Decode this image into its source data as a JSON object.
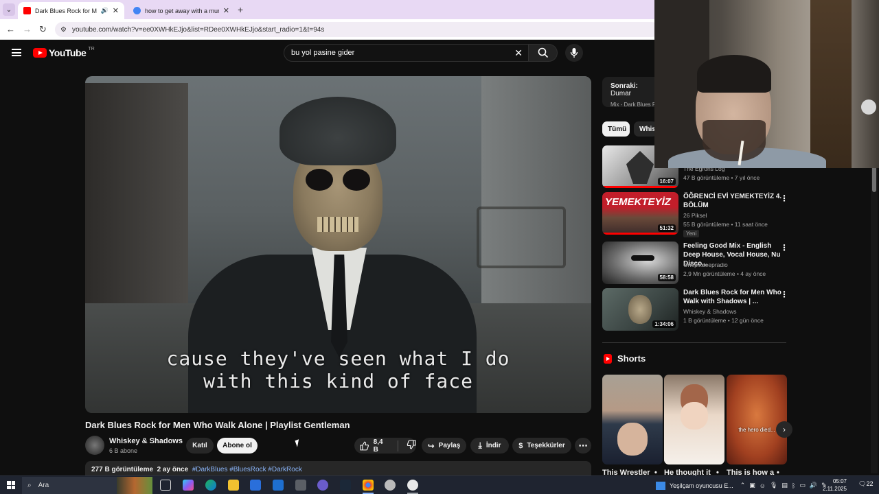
{
  "browser": {
    "tabs": [
      {
        "label": "Dark Blues Rock for Men W",
        "active": true,
        "favicon_color": "#ff0000"
      },
      {
        "label": "how to get away with a murder",
        "active": false,
        "favicon_color": "#4285f4"
      }
    ],
    "url": "youtube.com/watch?v=ee0XWHkEJjo&list=RDee0XWHkEJjo&start_radio=1&t=94s"
  },
  "youtube": {
    "logo_text": "YouTube",
    "country": "TR",
    "search_value": "bu yol pasine gider"
  },
  "video": {
    "lyric_line1": "cause they've seen what I do",
    "lyric_line2": "with this kind of face",
    "title": "Dark Blues Rock for Men Who Walk Alone | Playlist Gentleman",
    "channel_name": "Whiskey & Shadows",
    "subscribers": "6 B abone",
    "join_label": "Katıl",
    "subscribe_label": "Abone ol",
    "likes": "8,4 B",
    "share_label": "Paylaş",
    "download_label": "İndir",
    "thanks_label": "Teşekkürler",
    "views": "277 B görüntüleme",
    "date": "2 ay önce",
    "hashtags": "#DarkBlues #BluesRock #DarkRock"
  },
  "sidebar": {
    "next_label": "Sonraki:",
    "next_title": "Dumar",
    "next_mix": "Mix - Dark Blues R",
    "chips": [
      "Tümü",
      "Whisk"
    ],
    "recommendations": [
      {
        "duration": "16:07",
        "title": "",
        "channel": "The Egrons Log",
        "meta": "47 B görüntüleme • 7 yıl önce",
        "badge": ""
      },
      {
        "duration": "51:32",
        "title": "ÖĞRENCİ EVİ YEMEKTEYİZ 4. BÖLÜM",
        "channel": "26 Piksel",
        "meta": "55 B görüntüleme • 11 saat önce",
        "badge": "Yeni"
      },
      {
        "duration": "58:58",
        "title": "Feeling Good Mix - English Deep House, Vocal House, Nu Disco...",
        "channel": "Onepixdeepradio",
        "meta": "2,9 Mn görüntüleme • 4 ay önce",
        "badge": ""
      },
      {
        "duration": "1:34:06",
        "title": "Dark Blues Rock for Men Who Walk with Shadows | ...",
        "channel": "Whiskey & Shadows",
        "meta": "1 B görüntüleme • 12 gün önce",
        "badge": ""
      }
    ],
    "shorts_heading": "Shorts",
    "shorts": [
      {
        "title": "This Wrestler",
        "overlay": ""
      },
      {
        "title": "He thought it",
        "overlay": ""
      },
      {
        "title": "This is how a",
        "overlay": "the hero died..."
      }
    ]
  },
  "taskbar": {
    "search_placeholder": "Ara",
    "weather": "Yeşilçam oyuncusu E...",
    "time": "05:07",
    "date": "2.11.2025",
    "notifications": "22"
  }
}
